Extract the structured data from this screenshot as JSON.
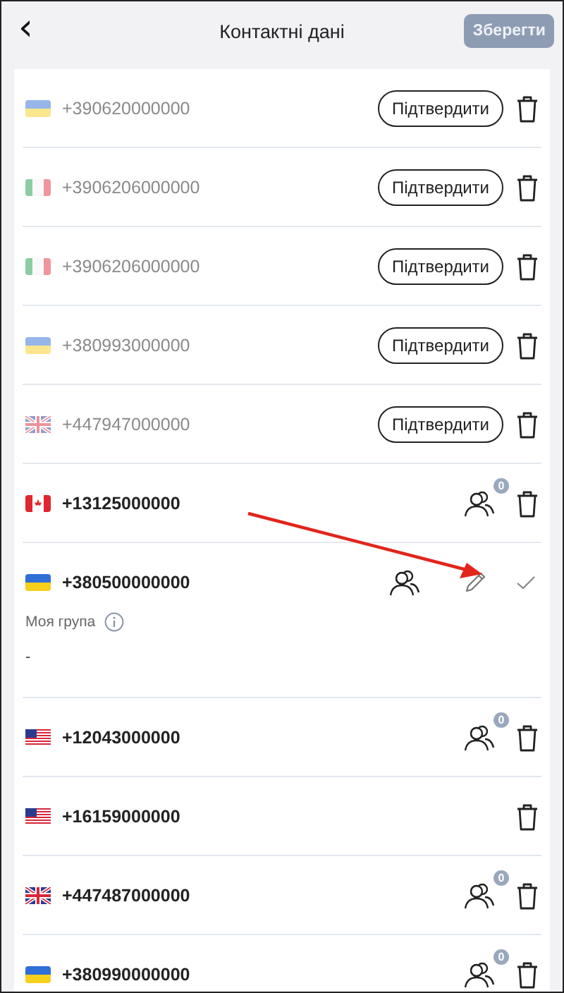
{
  "header": {
    "back": "‹",
    "title": "Контактні дані",
    "save": {
      "label": "Зберегти",
      "disabled": true
    }
  },
  "contacts": [
    {
      "flag": {
        "kind": "ua"
      },
      "phone": "+390620000000",
      "verified": false,
      "kind": "confirm",
      "action": "Підтвердити"
    },
    {
      "flag": {
        "kind": "it"
      },
      "phone": "+3906206000000",
      "verified": false,
      "kind": "confirm",
      "action": "Підтвердити"
    },
    {
      "flag": {
        "kind": "it"
      },
      "phone": "+3906206000000",
      "verified": false,
      "kind": "confirm",
      "action": "Підтвердити"
    },
    {
      "flag": {
        "kind": "ua"
      },
      "phone": "+380993000000",
      "verified": false,
      "kind": "confirm",
      "action": "Підтвердити"
    },
    {
      "flag": {
        "kind": "gb"
      },
      "phone": "+447947000000",
      "verified": false,
      "kind": "confirm",
      "action": "Підтвердити"
    },
    {
      "flag": {
        "kind": "ca"
      },
      "phone": "+13125000000",
      "verified": true,
      "kind": "group",
      "badge": "0"
    },
    {
      "flag": {
        "kind": "ua"
      },
      "phone": "+380500000000",
      "verified": true,
      "kind": "edit",
      "group_label": "Моя група",
      "group_value": "-"
    },
    {
      "flag": {
        "kind": "us"
      },
      "phone": "+12043000000",
      "verified": true,
      "kind": "group",
      "badge": "0"
    },
    {
      "flag": {
        "kind": "us"
      },
      "phone": "+16159000000",
      "verified": true,
      "kind": "none"
    },
    {
      "flag": {
        "kind": "gb"
      },
      "phone": "+447487000000",
      "verified": true,
      "kind": "group",
      "badge": "0"
    },
    {
      "flag": {
        "kind": "ua"
      },
      "phone": "+380990000000",
      "verified": true,
      "kind": "group",
      "badge": "0"
    }
  ]
}
